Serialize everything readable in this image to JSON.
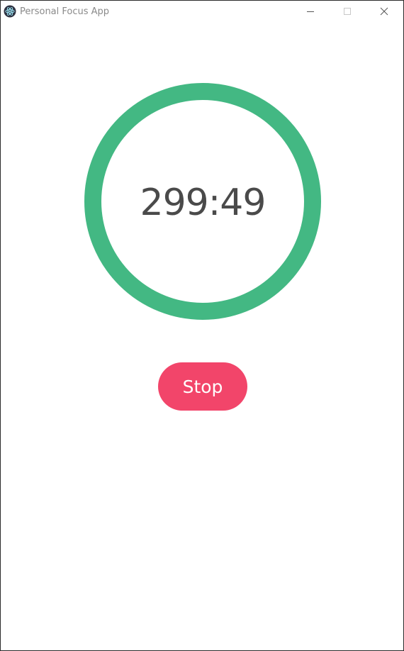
{
  "window": {
    "title": "Personal Focus App",
    "icon": "electron-atom-icon",
    "controls": [
      "minimize-icon",
      "maximize-icon",
      "close-icon"
    ]
  },
  "timer": {
    "display": "299:49",
    "ring_color": "#43b883"
  },
  "actions": {
    "stop_label": "Stop",
    "stop_color": "#f2456a"
  }
}
